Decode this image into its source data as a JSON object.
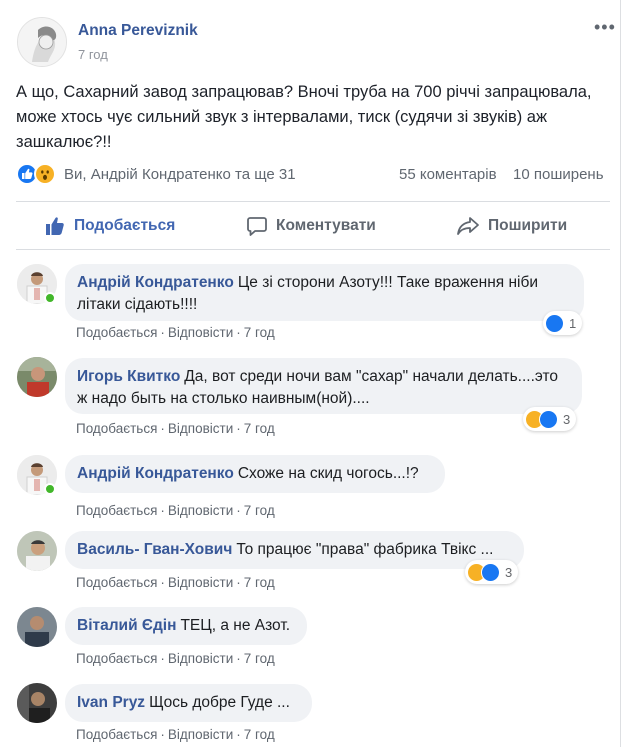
{
  "post": {
    "author": "Anna Pereviznik",
    "time": "7 год",
    "text": "А що, Сахарний завод запрацював? Вночі труба на 700 річчі запрацювала, може хтось чує сильний звук з інтервалами, тиск (судячи зі звуків) аж зашкалює?!!",
    "more_icon": "three-dots-icon",
    "reactions": {
      "icons": [
        "like-icon",
        "wow-icon"
      ],
      "names": "Ви, Андрій Кондратенко та ще 31",
      "comments": "55 коментарів",
      "shares": "10 поширень"
    },
    "actions": {
      "like": "Подобається",
      "comment": "Коментувати",
      "share": "Поширити"
    },
    "colors": {
      "link": "#385898",
      "like_active": "#4267b2",
      "bubble": "#f0f2f5"
    }
  },
  "comment_actions": {
    "like": "Подобається",
    "reply": "Відповісти"
  },
  "comments": [
    {
      "author": "Андрій Кондратенко",
      "text": "Це зі сторони Азоту!!! Таке враження ніби літаки сідають!!!!",
      "time": "7 год",
      "reaction_count": "1",
      "reactions": [
        "like"
      ]
    },
    {
      "author": "Игорь Квитко",
      "text": "Да, вот среди ночи вам \"сахар\" начали делать....это ж надо быть на столько наивным(ной)....",
      "time": "7 год",
      "reaction_count": "3",
      "reactions": [
        "haha",
        "like"
      ]
    },
    {
      "author": "Андрій Кондратенко",
      "text": "Схоже на скид чогось...!?",
      "time": "7 год",
      "reaction_count": "",
      "reactions": []
    },
    {
      "author": "Василь- Гван-Хович",
      "text": "То працює \"права\" фабрика Твікс ...",
      "time": "7 год",
      "reaction_count": "3",
      "reactions": [
        "haha",
        "like"
      ]
    },
    {
      "author": "Віталий Єдін",
      "text": "ТЕЦ, а не Азот.",
      "time": "7 год",
      "reaction_count": "",
      "reactions": []
    },
    {
      "author": "Ivan Pryz",
      "text": "Щось добре Гуде ...",
      "time": "7 год",
      "reaction_count": "",
      "reactions": []
    }
  ]
}
